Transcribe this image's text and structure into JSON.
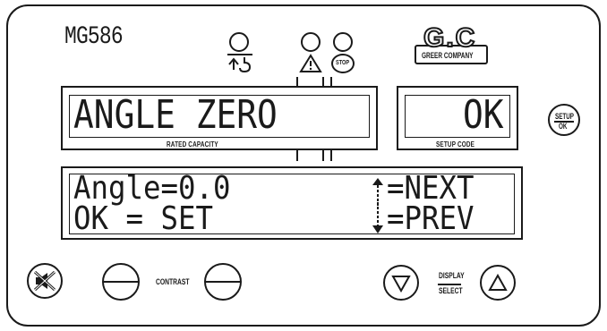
{
  "header": {
    "model": "MG586",
    "logo_main": "G.C",
    "logo_sub": "GREER COMPANY",
    "stop_label": "STOP"
  },
  "lamps": [
    {
      "name": "load-lamp",
      "icon": "hook-arrow-icon"
    },
    {
      "name": "warning-lamp",
      "icon": "warning-triangle-icon"
    },
    {
      "name": "stop-lamp",
      "icon": "stop-sign-icon"
    }
  ],
  "main_display": {
    "text": "ANGLE ZERO",
    "caption": "RATED CAPACITY"
  },
  "setup_display": {
    "text": "OK",
    "caption": "SETUP CODE"
  },
  "setup_button": {
    "top": "SETUP",
    "bottom": "OK"
  },
  "message_display": {
    "line1_left": "Angle=0.0",
    "line1_right": "=NEXT",
    "line2_left": "OK = SET",
    "line2_right": "=PREV"
  },
  "controls": {
    "contrast_label": "CONTRAST",
    "display_label_top": "DISPLAY",
    "display_label_bottom": "SELECT"
  },
  "colors": {
    "ink": "#1a1a1a",
    "background": "#ffffff"
  }
}
